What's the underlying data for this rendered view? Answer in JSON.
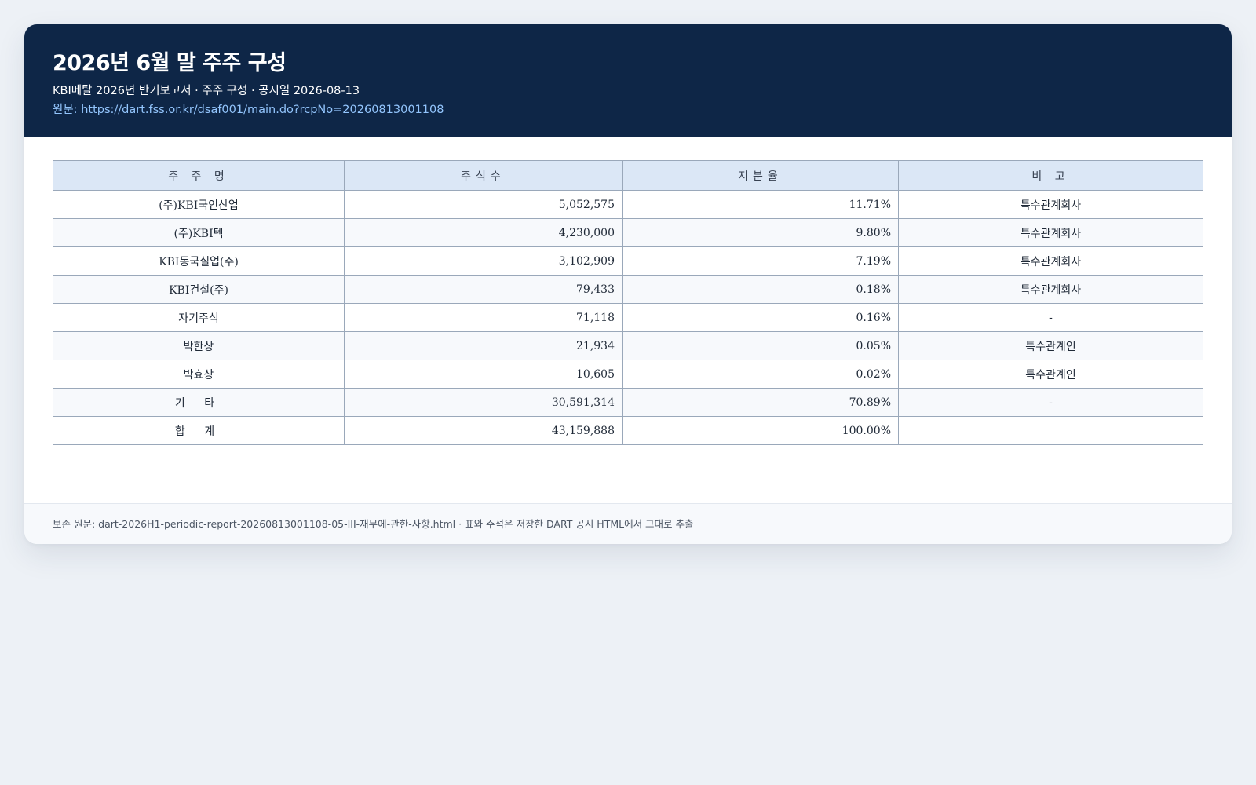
{
  "header": {
    "title": "2026년 6월 말 주주 구성",
    "meta": "KBI메탈 2026년 반기보고서 · 주주 구성 · 공시일 2026-08-13",
    "source_prefix": "원문: ",
    "source_url": "https://dart.fss.or.kr/dsaf001/main.do?rcpNo=20260813001108"
  },
  "table": {
    "columns": [
      "주 주 명",
      "주식수",
      "지분율",
      "비 고"
    ],
    "rows": [
      {
        "name": "(주)KBI국인산업",
        "shares": "5,052,575",
        "ratio": "11.71%",
        "note": "특수관계회사"
      },
      {
        "name": "(주)KBI텍",
        "shares": "4,230,000",
        "ratio": "9.80%",
        "note": "특수관계회사"
      },
      {
        "name": "KBI동국실업(주)",
        "shares": "3,102,909",
        "ratio": "7.19%",
        "note": "특수관계회사"
      },
      {
        "name": "KBI건설(주)",
        "shares": "79,433",
        "ratio": "0.18%",
        "note": "특수관계회사"
      },
      {
        "name": "자기주식",
        "shares": "71,118",
        "ratio": "0.16%",
        "note": "-"
      },
      {
        "name": "박한상",
        "shares": "21,934",
        "ratio": "0.05%",
        "note": "특수관계인"
      },
      {
        "name": "박효상",
        "shares": "10,605",
        "ratio": "0.02%",
        "note": "특수관계인"
      },
      {
        "name": "기 타",
        "shares": "30,591,314",
        "ratio": "70.89%",
        "note": "-"
      },
      {
        "name": "합 계",
        "shares": "43,159,888",
        "ratio": "100.00%",
        "note": ""
      }
    ]
  },
  "footer": {
    "text": "보존 원문: dart-2026H1-periodic-report-20260813001108-05-III-재무에-관한-사항.html · 표와 주석은 저장한 DART 공시 HTML에서 그대로 추출"
  }
}
